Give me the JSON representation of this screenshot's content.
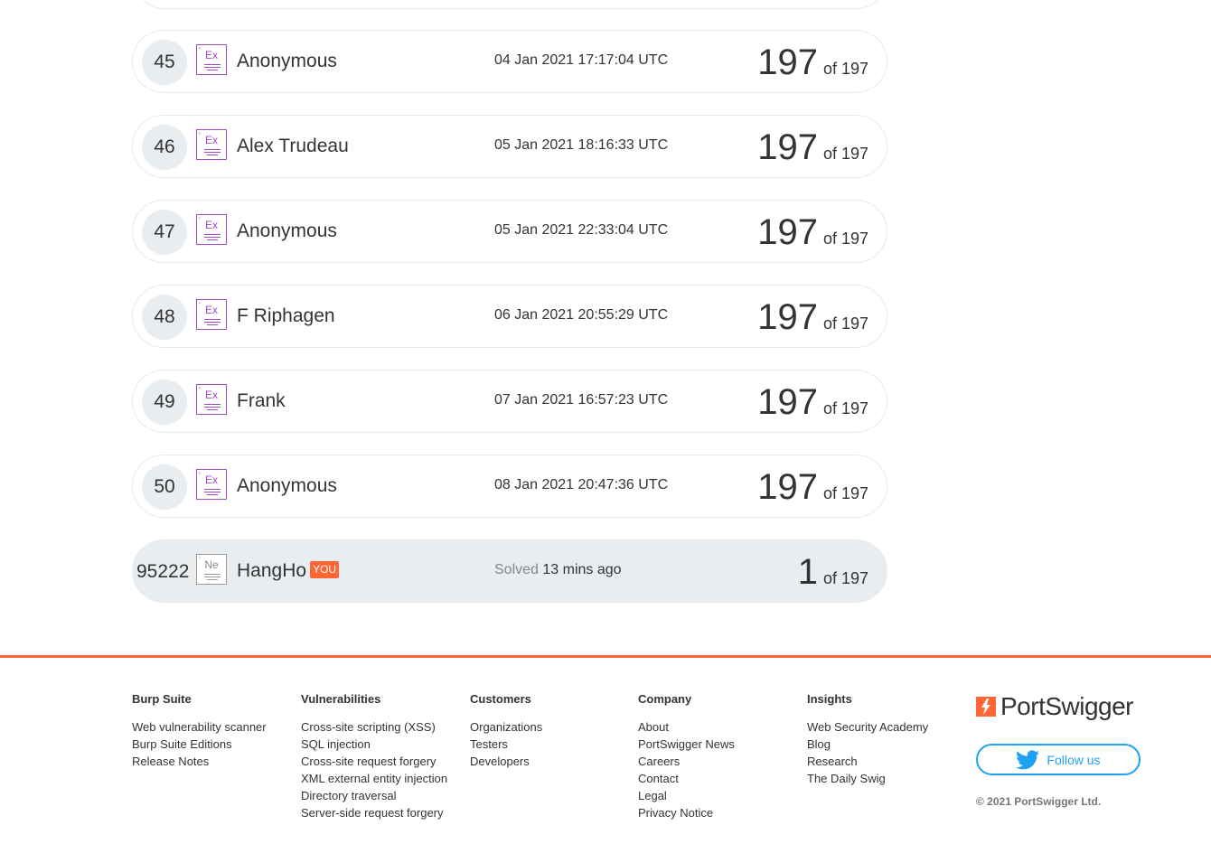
{
  "leaderboard": {
    "rows": [
      {
        "rank": "45",
        "badge": "Ex",
        "name": "Anonymous",
        "date": "04 Jan 2021 17:17:04 UTC",
        "score": "197",
        "of_label": "of 197"
      },
      {
        "rank": "46",
        "badge": "Ex",
        "name": "Alex Trudeau",
        "date": "05 Jan 2021 18:16:33 UTC",
        "score": "197",
        "of_label": "of 197"
      },
      {
        "rank": "47",
        "badge": "Ex",
        "name": "Anonymous",
        "date": "05 Jan 2021 22:33:04 UTC",
        "score": "197",
        "of_label": "of 197"
      },
      {
        "rank": "48",
        "badge": "Ex",
        "name": "F Riphagen",
        "date": "06 Jan 2021 20:55:29 UTC",
        "score": "197",
        "of_label": "of 197"
      },
      {
        "rank": "49",
        "badge": "Ex",
        "name": "Frank",
        "date": "07 Jan 2021 16:57:23 UTC",
        "score": "197",
        "of_label": "of 197"
      },
      {
        "rank": "50",
        "badge": "Ex",
        "name": "Anonymous",
        "date": "08 Jan 2021 20:47:36 UTC",
        "score": "197",
        "of_label": "of 197"
      }
    ],
    "you_row": {
      "rank": "95222",
      "badge": "Ne",
      "name": "HangHo",
      "you_tag": "YOU",
      "solved_label": "Solved",
      "solved_time": "13 mins ago",
      "score": "1",
      "of_label": "of 197"
    }
  },
  "footer": {
    "columns": [
      {
        "heading": "Burp Suite",
        "links": [
          "Web vulnerability scanner",
          "Burp Suite Editions",
          "Release Notes"
        ]
      },
      {
        "heading": "Vulnerabilities",
        "links": [
          "Cross-site scripting (XSS)",
          "SQL injection",
          "Cross-site request forgery",
          "XML external entity injection",
          "Directory traversal",
          "Server-side request forgery"
        ]
      },
      {
        "heading": "Customers",
        "links": [
          "Organizations",
          "Testers",
          "Developers"
        ]
      },
      {
        "heading": "Company",
        "links": [
          "About",
          "PortSwigger News",
          "Careers",
          "Contact",
          "Legal",
          "Privacy Notice"
        ]
      },
      {
        "heading": "Insights",
        "links": [
          "Web Security Academy",
          "Blog",
          "Research",
          "The Daily Swig"
        ]
      }
    ],
    "brand": {
      "logo_text": "PortSwigger",
      "follow_label": "Follow us",
      "copyright": "© 2021 PortSwigger Ltd."
    }
  },
  "colors": {
    "accent": "#ff6633",
    "expert_badge": "#a24bc1",
    "twitter": "#1da1f2",
    "row_highlight": "#e9edef"
  }
}
